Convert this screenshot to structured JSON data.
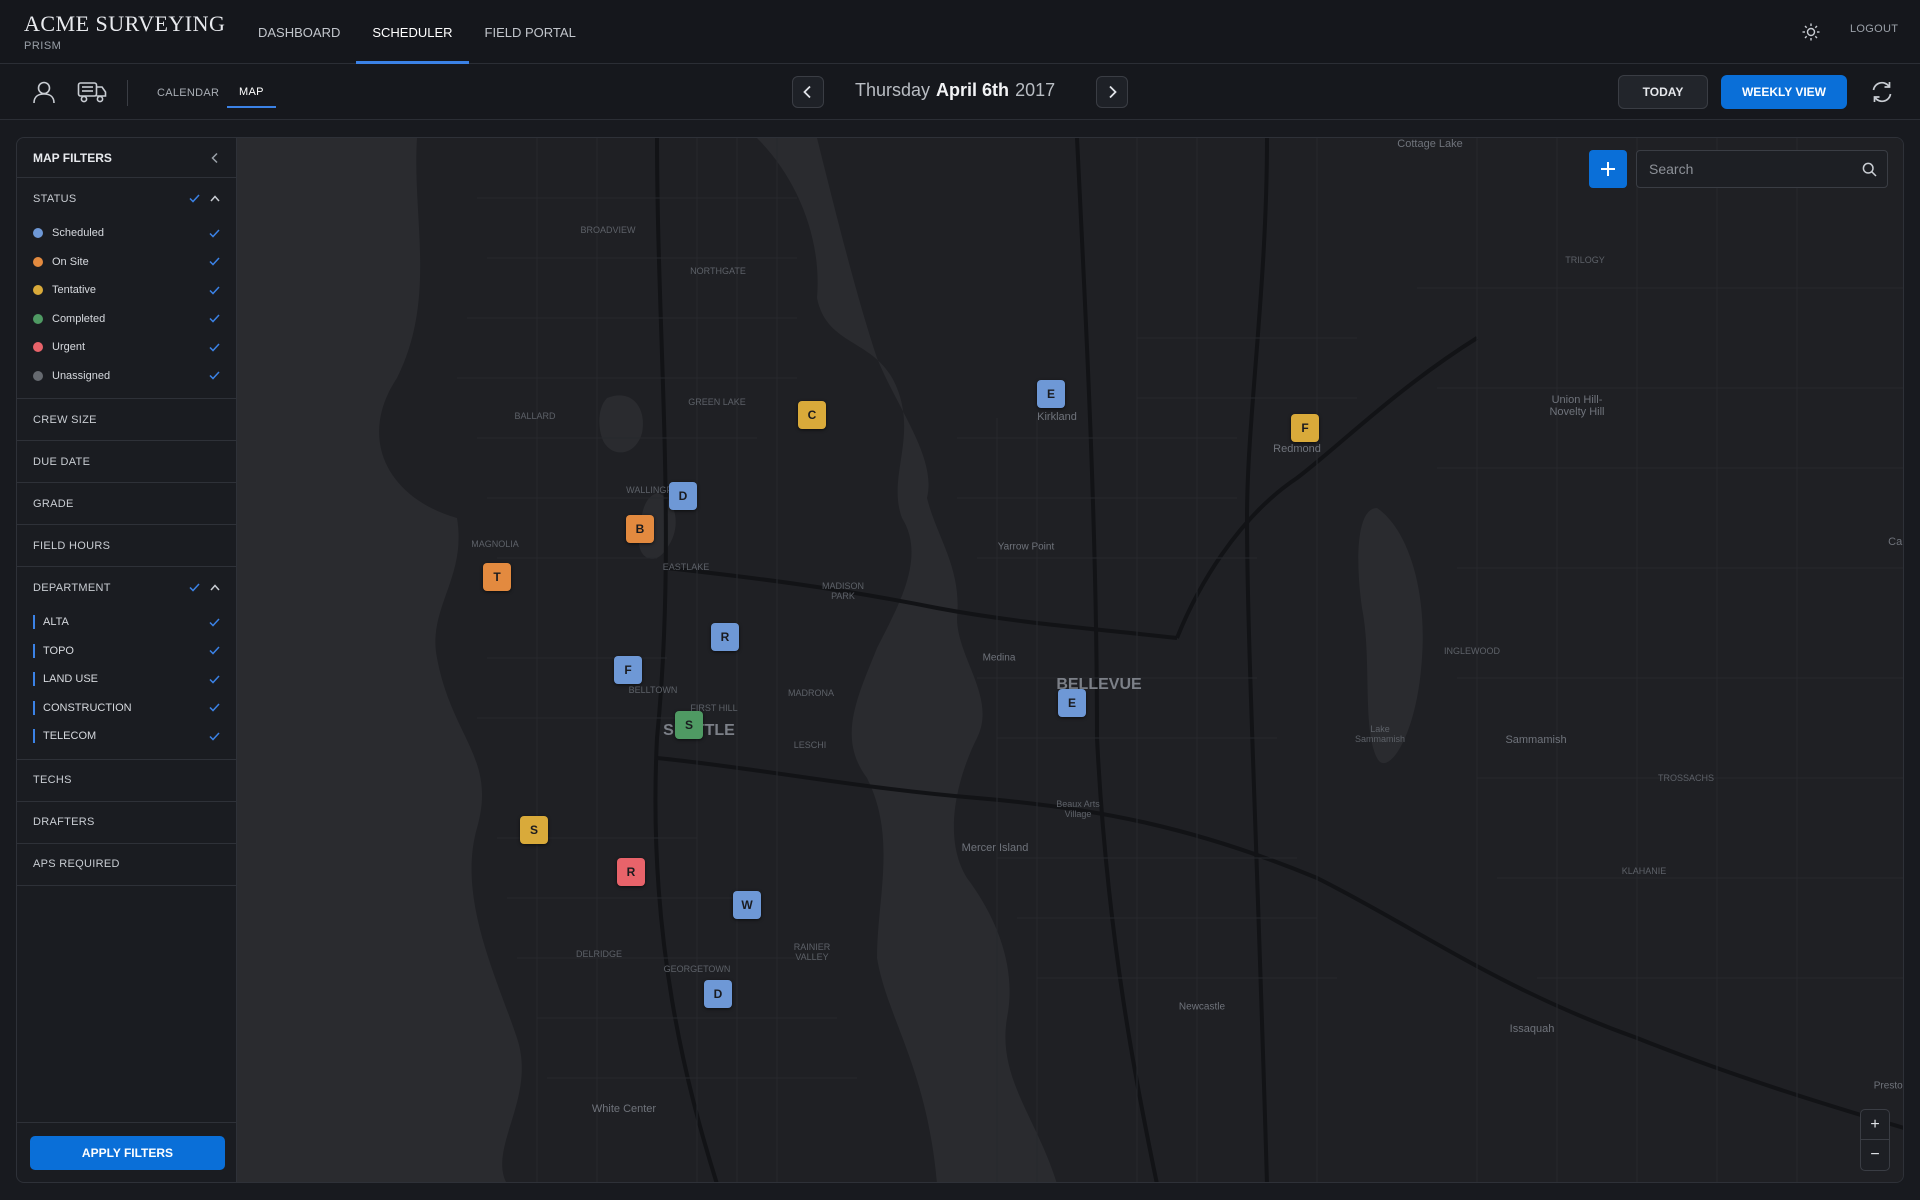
{
  "header": {
    "brand_title": "ACME SURVEYING",
    "brand_sub": "PRISM",
    "nav": [
      "DASHBOARD",
      "SCHEDULER",
      "FIELD PORTAL"
    ],
    "active_nav": "SCHEDULER",
    "logout": "LOGOUT"
  },
  "toolbar": {
    "view_tabs": [
      "CALENDAR",
      "MAP"
    ],
    "active_view": "MAP",
    "date": {
      "weekday": "Thursday",
      "day": "April 6th",
      "year": "2017"
    },
    "today_label": "TODAY",
    "weekly_label": "WEEKLY VIEW"
  },
  "filters": {
    "title": "MAP FILTERS",
    "status": {
      "label": "STATUS",
      "items": [
        {
          "label": "Scheduled",
          "color": "#6e98d6"
        },
        {
          "label": "On Site",
          "color": "#e38a3f"
        },
        {
          "label": "Tentative",
          "color": "#d9aa3a"
        },
        {
          "label": "Completed",
          "color": "#4f9a63"
        },
        {
          "label": "Urgent",
          "color": "#e8636a"
        },
        {
          "label": "Unassigned",
          "color": "#666a70"
        }
      ]
    },
    "crew_size": "CREW SIZE",
    "due_date": "DUE DATE",
    "grade": "GRADE",
    "field_hours": "FIELD HOURS",
    "department": {
      "label": "DEPARTMENT",
      "items": [
        "ALTA",
        "TOPO",
        "LAND USE",
        "CONSTRUCTION",
        "TELECOM"
      ]
    },
    "techs": "TECHS",
    "drafters": "DRAFTERS",
    "aps_required": "APS REQUIRED",
    "apply_label": "APPLY FILTERS"
  },
  "map": {
    "search_placeholder": "Search",
    "zoom_in": "+",
    "zoom_out": "−",
    "places": {
      "cottage_lake": "Cottage Lake",
      "broadview": "BROADVIEW",
      "northgate": "NORTHGATE",
      "trilogy": "TRILOGY",
      "green_lake": "GREEN LAKE",
      "ballard": "BALLARD",
      "kirkland": "Kirkland",
      "redmond": "Redmond",
      "union_hill": "Union Hill-\nNovelty Hill",
      "wallingford": "WALLINGFORD",
      "magnolia": "MAGNOLIA",
      "eastlake": "EASTLAKE",
      "yarrow_point": "Yarrow Point",
      "madison_park": "MADISON\nPARK",
      "medina": "Medina",
      "bellevue": "BELLEVUE",
      "inglewood": "INGLEWOOD",
      "car": "Car",
      "belltown": "BELLTOWN",
      "first_hill": "FIRST HILL",
      "madrona": "MADRONA",
      "seattle": "SEATTLE",
      "leschi": "LESCHI",
      "lake_samm": "Lake\nSammamish",
      "sammamish": "Sammamish",
      "trossachs": "TROSSACHS",
      "beaux_arts": "Beaux Arts\nVillage",
      "mercer_island": "Mercer Island",
      "klahanie": "KLAHANIE",
      "delridge": "DELRIDGE",
      "rainier_valley": "RAINIER\nVALLEY",
      "georgetown": "GEORGETOWN",
      "newcastle": "Newcastle",
      "issaquah": "Issaquah",
      "white_center": "White Center",
      "preston": "Preston"
    },
    "markers": [
      {
        "letter": "E",
        "status": "Scheduled"
      },
      {
        "letter": "C",
        "status": "Tentative"
      },
      {
        "letter": "F",
        "status": "Tentative"
      },
      {
        "letter": "D",
        "status": "Scheduled"
      },
      {
        "letter": "B",
        "status": "On Site"
      },
      {
        "letter": "T",
        "status": "On Site"
      },
      {
        "letter": "R",
        "status": "Scheduled"
      },
      {
        "letter": "F",
        "status": "Scheduled"
      },
      {
        "letter": "S",
        "status": "Completed"
      },
      {
        "letter": "E",
        "status": "Scheduled"
      },
      {
        "letter": "S",
        "status": "Tentative"
      },
      {
        "letter": "R",
        "status": "Urgent"
      },
      {
        "letter": "W",
        "status": "Scheduled"
      },
      {
        "letter": "D",
        "status": "Scheduled"
      }
    ]
  }
}
